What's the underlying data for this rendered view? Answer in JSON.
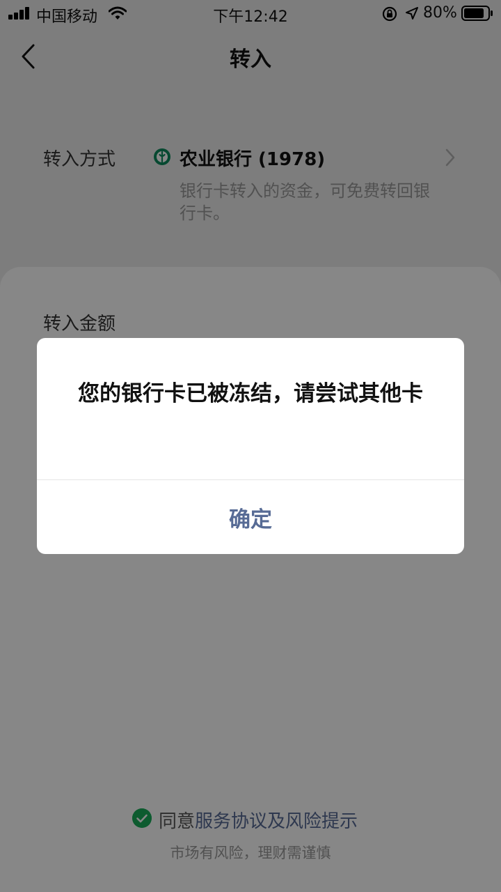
{
  "status_bar": {
    "carrier": "中国移动",
    "time": "下午12:42",
    "battery": "80%"
  },
  "nav": {
    "title": "转入",
    "back_icon": "chevron-left-icon"
  },
  "transfer_method": {
    "label": "转入方式",
    "bank_name": "农业银行 (1978)",
    "bank_logo": "abc-bank-logo",
    "note": "银行卡转入的资金，可免费转回银行卡。",
    "chevron_icon": "chevron-right-icon"
  },
  "amount": {
    "label": "转入金额"
  },
  "footer": {
    "agree_prefix": "同意",
    "agree_link": "服务协议及风险提示",
    "risk_tip": "市场有风险，理财需谨慎"
  },
  "dialog": {
    "message": "您的银行卡已被冻结，请尝试其他卡",
    "ok_label": "确定"
  },
  "colors": {
    "link": "#576b95",
    "brand_green": "#1aad5a",
    "bank_green": "#0f8b5e",
    "mask": "rgba(0,0,0,0.47)"
  }
}
